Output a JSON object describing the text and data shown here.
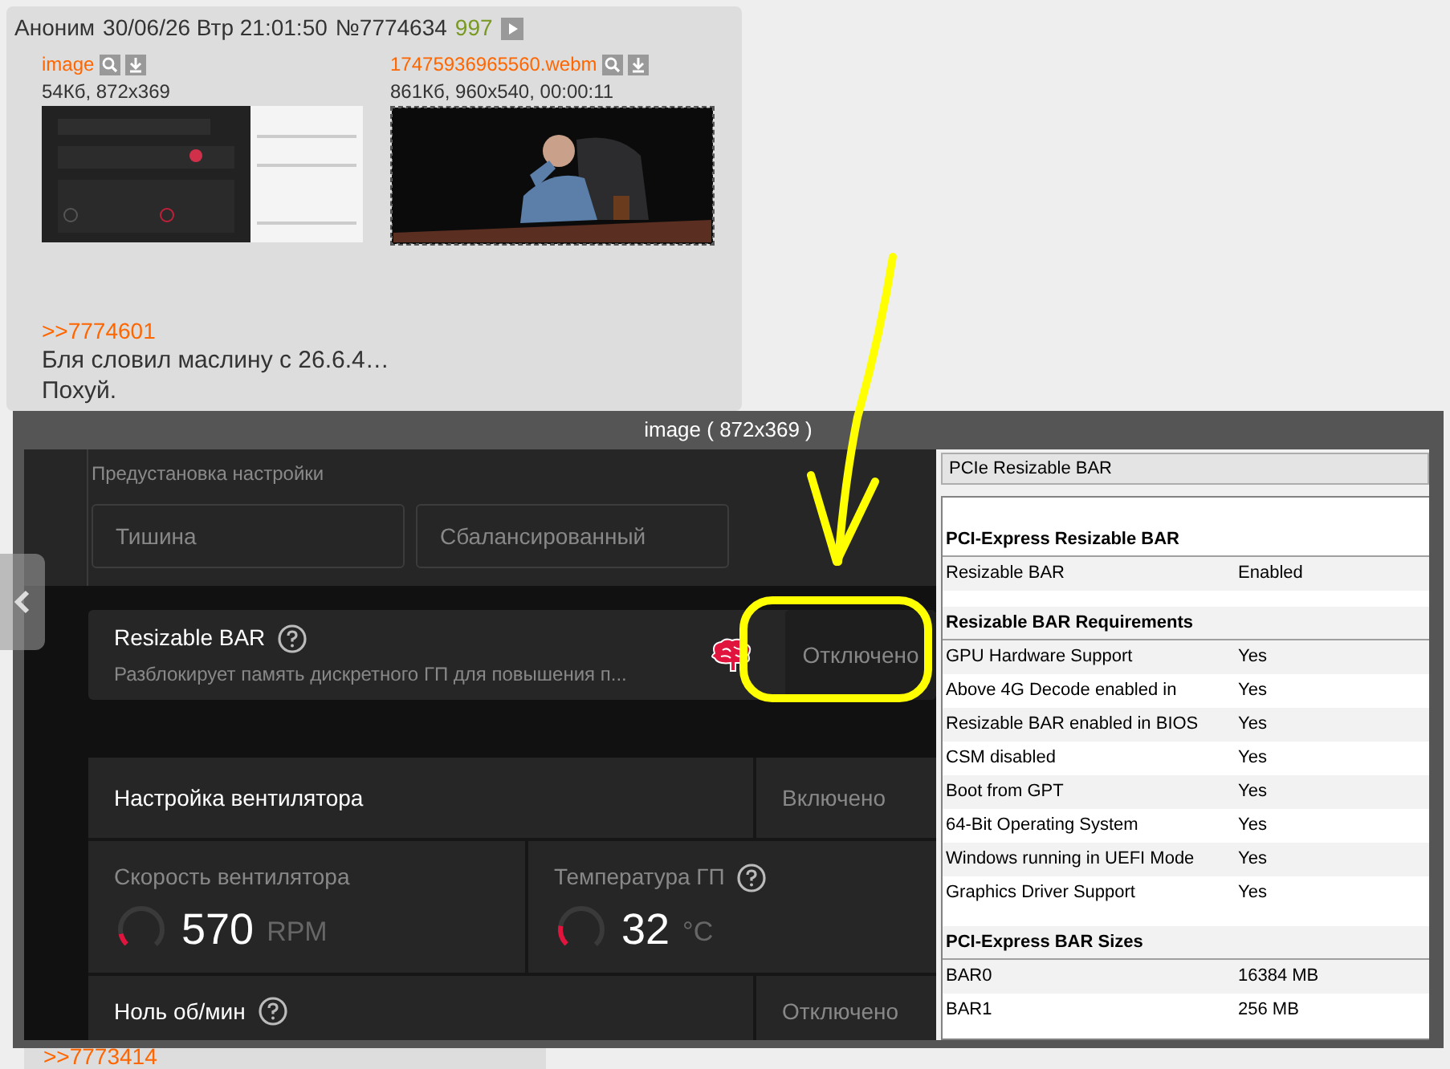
{
  "post": {
    "author": "Аноним",
    "date": "30/06/26 Втр 21:01:50",
    "number": "№7774634",
    "count": "997",
    "files": [
      {
        "name": "image",
        "meta": "54Кб, 872x369",
        "kind": "screenshot"
      },
      {
        "name": "17475936965560.webm",
        "meta": "861Кб, 960x540, 00:00:11",
        "kind": "video"
      }
    ],
    "reply_link": ">>7774601",
    "lines": [
      "Бля словил маслину с 26.6.4…",
      "Похуй."
    ]
  },
  "viewer": {
    "title": "image ( 872x369 )",
    "amd": {
      "preset_label": "Предустановка настройки",
      "presets": [
        "Тишина",
        "Сбалансированный"
      ],
      "resizable_bar": {
        "title": "Resizable BAR",
        "description": "Разблокирует память дискретного ГП для повышения п...",
        "value": "Отключено"
      },
      "fan": {
        "title": "Настройка вентилятора",
        "value": "Включено"
      },
      "gauges": [
        {
          "label": "Скорость вентилятора",
          "value": "570",
          "unit": "RPM",
          "help": false,
          "level": 0.12
        },
        {
          "label": "Температура ГП",
          "value": "32",
          "unit": "°C",
          "help": true,
          "level": 0.2
        }
      ],
      "zero_rpm": {
        "title": "Ноль об/мин",
        "value": "Отключено"
      }
    },
    "gpuz": {
      "dropdown": "PCIe Resizable BAR",
      "sections": [
        {
          "title": "PCI-Express Resizable BAR",
          "rows": [
            {
              "name": "Resizable BAR",
              "value": "Enabled"
            }
          ]
        },
        {
          "title": "Resizable BAR Requirements",
          "rows": [
            {
              "name": "GPU Hardware Support",
              "value": "Yes"
            },
            {
              "name": "Above 4G Decode enabled in",
              "value": "Yes"
            },
            {
              "name": "Resizable BAR enabled in BIOS",
              "value": "Yes"
            },
            {
              "name": "CSM disabled",
              "value": "Yes"
            },
            {
              "name": "Boot from GPT",
              "value": "Yes"
            },
            {
              "name": "64-Bit Operating System",
              "value": "Yes"
            },
            {
              "name": "Windows running in UEFI Mode",
              "value": "Yes"
            },
            {
              "name": "Graphics Driver Support",
              "value": "Yes"
            }
          ]
        },
        {
          "title": "PCI-Express BAR Sizes",
          "rows": [
            {
              "name": "BAR0",
              "value": "16384 MB"
            },
            {
              "name": "BAR1",
              "value": "256 MB"
            }
          ]
        }
      ]
    }
  },
  "next_post": {
    "reply_link": ">>7773414"
  }
}
